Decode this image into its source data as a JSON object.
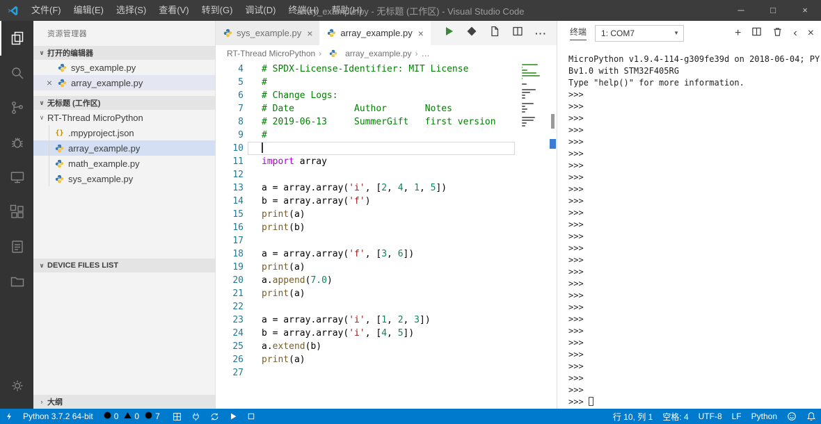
{
  "title_bar": {
    "menus": [
      "文件(F)",
      "编辑(E)",
      "选择(S)",
      "查看(V)",
      "转到(G)",
      "调试(D)",
      "终端(H)",
      "帮助(H)"
    ],
    "title": "array_example.py - 无标题 (工作区) - Visual Studio Code"
  },
  "icons": {
    "minimize": "─",
    "maximize": "□",
    "close": "×",
    "chevron_down": "∨",
    "chevron_right": "›",
    "chevron_left": "‹",
    "dropdown_arrow": "▼",
    "plus": "+",
    "more": "···",
    "breadcrumb_more": "…",
    "json_braces": "{}"
  },
  "sidebar": {
    "title": "资源管理器",
    "open_editors_label": "打开的编辑器",
    "open_editors": [
      {
        "name": "sys_example.py",
        "selected": false
      },
      {
        "name": "array_example.py",
        "selected": true
      }
    ],
    "workspace_label": "无标题 (工作区)",
    "folder_name": "RT-Thread MicroPython",
    "tree": [
      {
        "name": ".mpyproject.json",
        "icon": "json",
        "selected": false
      },
      {
        "name": "array_example.py",
        "icon": "python",
        "selected": true
      },
      {
        "name": "math_example.py",
        "icon": "python",
        "selected": false
      },
      {
        "name": "sys_example.py",
        "icon": "python",
        "selected": false
      }
    ],
    "device_files_label": "DEVICE FILES LIST",
    "outline_label": "大纲"
  },
  "editor": {
    "tabs": [
      {
        "label": "sys_example.py",
        "active": false
      },
      {
        "label": "array_example.py",
        "active": true
      }
    ],
    "breadcrumb": {
      "root": "RT-Thread MicroPython",
      "file": "array_example.py",
      "more": "…"
    },
    "current_line": 10,
    "code_lines": [
      {
        "n": 4,
        "t": [
          [
            "c",
            "# SPDX-License-Identifier: MIT License"
          ]
        ]
      },
      {
        "n": 5,
        "t": [
          [
            "c",
            "#"
          ]
        ]
      },
      {
        "n": 6,
        "t": [
          [
            "c",
            "# Change Logs:"
          ]
        ]
      },
      {
        "n": 7,
        "t": [
          [
            "c",
            "# Date           Author       Notes"
          ]
        ]
      },
      {
        "n": 8,
        "t": [
          [
            "c",
            "# 2019-06-13     SummerGift   first version"
          ]
        ]
      },
      {
        "n": 9,
        "t": [
          [
            "c",
            "#"
          ]
        ]
      },
      {
        "n": 10,
        "t": []
      },
      {
        "n": 11,
        "t": [
          [
            "k",
            "import"
          ],
          [
            "p",
            " array"
          ]
        ]
      },
      {
        "n": 12,
        "t": []
      },
      {
        "n": 13,
        "t": [
          [
            "p",
            "a = array.array("
          ],
          [
            "s",
            "'i'"
          ],
          [
            "p",
            ", ["
          ],
          [
            "n",
            "2"
          ],
          [
            "p",
            ", "
          ],
          [
            "n",
            "4"
          ],
          [
            "p",
            ", "
          ],
          [
            "n",
            "1"
          ],
          [
            "p",
            ", "
          ],
          [
            "n",
            "5"
          ],
          [
            "p",
            "])"
          ]
        ]
      },
      {
        "n": 14,
        "t": [
          [
            "p",
            "b = array.array("
          ],
          [
            "s",
            "'f'"
          ],
          [
            "p",
            ")"
          ]
        ]
      },
      {
        "n": 15,
        "t": [
          [
            "f",
            "print"
          ],
          [
            "p",
            "(a)"
          ]
        ]
      },
      {
        "n": 16,
        "t": [
          [
            "f",
            "print"
          ],
          [
            "p",
            "(b)"
          ]
        ]
      },
      {
        "n": 17,
        "t": []
      },
      {
        "n": 18,
        "t": [
          [
            "p",
            "a = array.array("
          ],
          [
            "s",
            "'f'"
          ],
          [
            "p",
            ", ["
          ],
          [
            "n",
            "3"
          ],
          [
            "p",
            ", "
          ],
          [
            "n",
            "6"
          ],
          [
            "p",
            "])"
          ]
        ]
      },
      {
        "n": 19,
        "t": [
          [
            "f",
            "print"
          ],
          [
            "p",
            "(a)"
          ]
        ]
      },
      {
        "n": 20,
        "t": [
          [
            "p",
            "a."
          ],
          [
            "f",
            "append"
          ],
          [
            "p",
            "("
          ],
          [
            "n",
            "7.0"
          ],
          [
            "p",
            ")"
          ]
        ]
      },
      {
        "n": 21,
        "t": [
          [
            "f",
            "print"
          ],
          [
            "p",
            "(a)"
          ]
        ]
      },
      {
        "n": 22,
        "t": []
      },
      {
        "n": 23,
        "t": [
          [
            "p",
            "a = array.array("
          ],
          [
            "s",
            "'i'"
          ],
          [
            "p",
            ", ["
          ],
          [
            "n",
            "1"
          ],
          [
            "p",
            ", "
          ],
          [
            "n",
            "2"
          ],
          [
            "p",
            ", "
          ],
          [
            "n",
            "3"
          ],
          [
            "p",
            "])"
          ]
        ]
      },
      {
        "n": 24,
        "t": [
          [
            "p",
            "b = array.array("
          ],
          [
            "s",
            "'i'"
          ],
          [
            "p",
            ", ["
          ],
          [
            "n",
            "4"
          ],
          [
            "p",
            ", "
          ],
          [
            "n",
            "5"
          ],
          [
            "p",
            "])"
          ]
        ]
      },
      {
        "n": 25,
        "t": [
          [
            "p",
            "a."
          ],
          [
            "f",
            "extend"
          ],
          [
            "p",
            "(b)"
          ]
        ]
      },
      {
        "n": 26,
        "t": [
          [
            "f",
            "print"
          ],
          [
            "p",
            "(a)"
          ]
        ]
      },
      {
        "n": 27,
        "t": []
      }
    ]
  },
  "terminal": {
    "title": "终端",
    "selector_value": "1: COM7",
    "banner": [
      "MicroPython v1.9.4-114-g309fe39d on 2018-06-04; PY",
      "Bv1.0 with STM32F405RG",
      "Type \"help()\" for more information."
    ],
    "prompt": ">>>",
    "prompt_count": 26
  },
  "status_bar": {
    "python_version": "Python 3.7.2 64-bit",
    "errors": "0",
    "warnings": "0",
    "infos": "7",
    "line_col": "行 10, 列 1",
    "indent": "空格: 4",
    "encoding": "UTF-8",
    "eol": "LF",
    "language": "Python"
  },
  "colors": {
    "accent": "#007acc",
    "titlebar": "#3c3c3c",
    "activitybar": "#333333",
    "sidebar": "#f3f3f3",
    "comment": "#008000",
    "keyword": "#af00db",
    "string": "#a31515",
    "number": "#098658",
    "function": "#795e26"
  }
}
